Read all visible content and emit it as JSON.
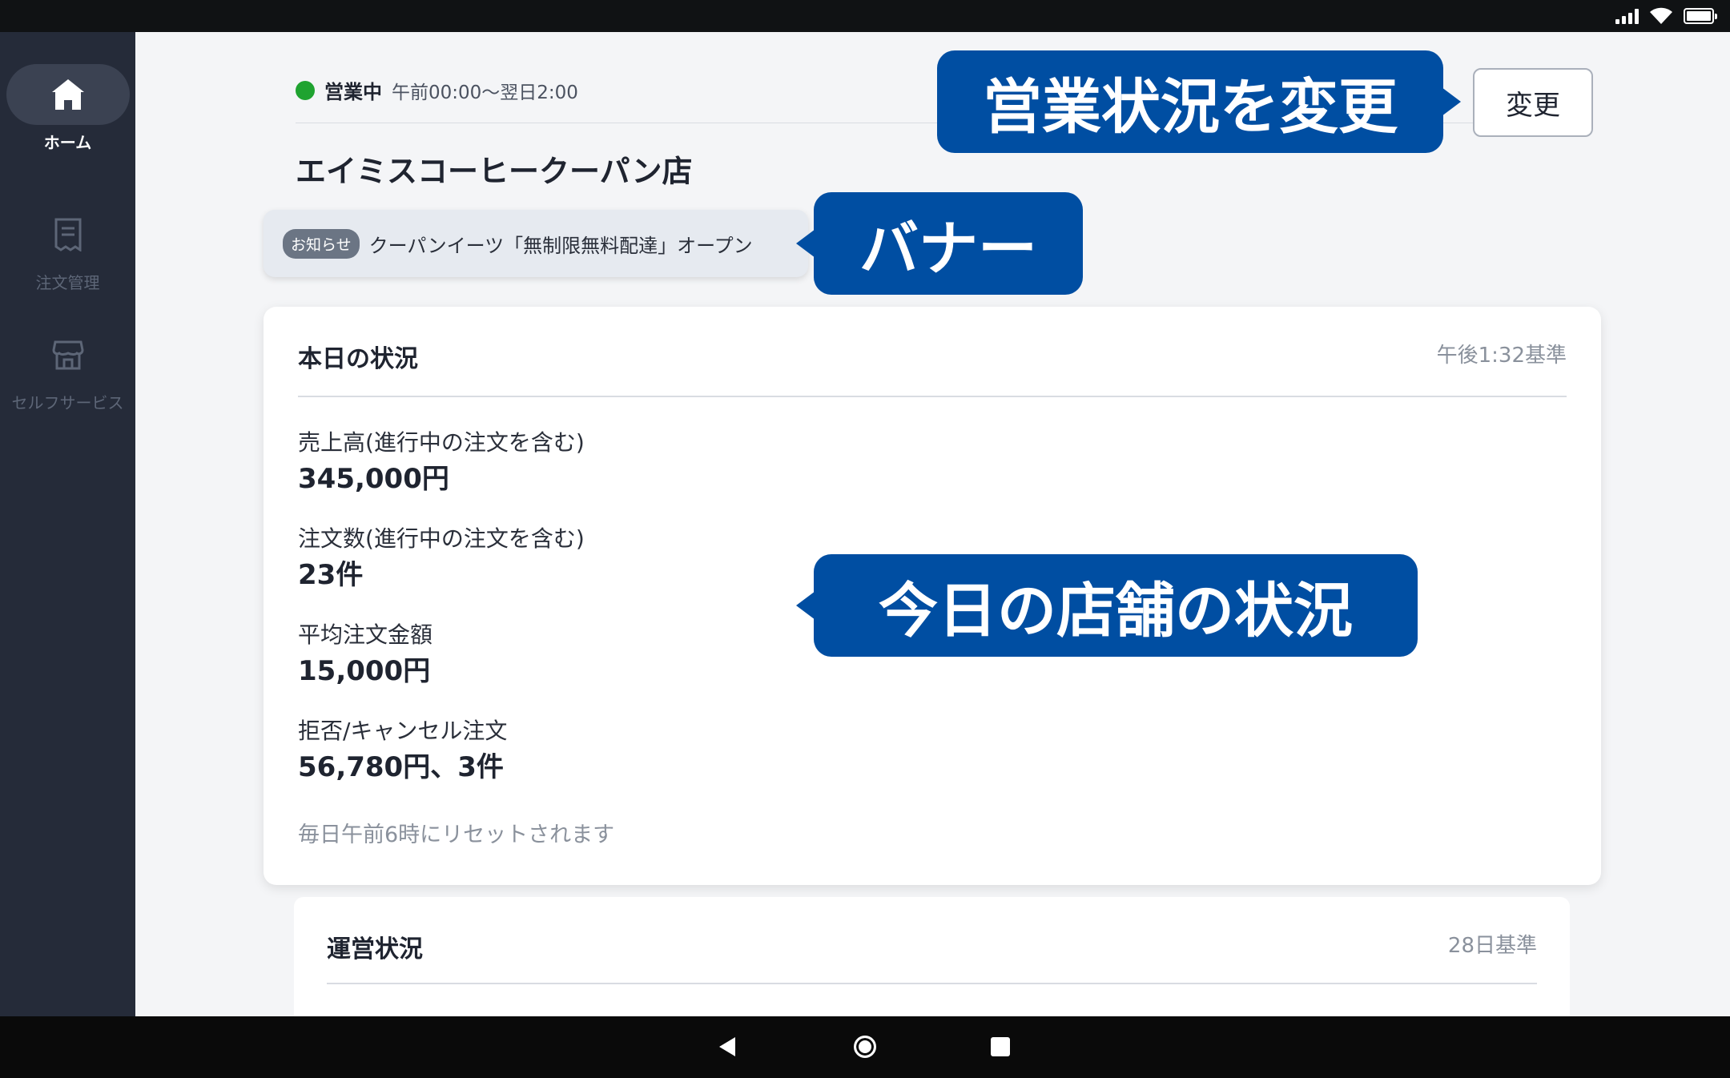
{
  "status_bar": {
    "icons": [
      "signal-icon",
      "wifi-icon",
      "battery-icon"
    ]
  },
  "sidebar": {
    "items": [
      {
        "label": "ホーム",
        "icon": "home-icon",
        "active": true
      },
      {
        "label": "注文管理",
        "icon": "receipt-icon",
        "active": false
      },
      {
        "label": "セルフサービス",
        "icon": "store-icon",
        "active": false
      }
    ]
  },
  "header": {
    "business_status": "営業中",
    "business_hours": "午前00:00〜翌日2:00",
    "change_button_label": "変更",
    "store_name": "エイミスコーヒークーパン店"
  },
  "notice": {
    "badge": "お知らせ",
    "text": "クーパンイーツ「無制限無料配達」オープン"
  },
  "today_card": {
    "title": "本日の状況",
    "timestamp": "午後1:32基準",
    "metrics": [
      {
        "label": "売上高(進行中の注文を含む)",
        "value": "345,000円"
      },
      {
        "label": "注文数(進行中の注文を含む)",
        "value": "23件"
      },
      {
        "label": "平均注文金額",
        "value": "15,000円"
      },
      {
        "label": "拒否/キャンセル注文",
        "value": "56,780円、3件"
      }
    ],
    "reset_note": "毎日午前6時にリセットされます"
  },
  "operations_card": {
    "title": "運営状況",
    "timestamp": "28日基準"
  },
  "callouts": {
    "status": "営業状況を変更",
    "banner": "バナー",
    "today": "今日の店舗の状況"
  },
  "colors": {
    "sidebar_bg": "#252b39",
    "callout_bg": "#004ea2",
    "status_green": "#1fa330",
    "page_bg": "#f4f5f7"
  }
}
